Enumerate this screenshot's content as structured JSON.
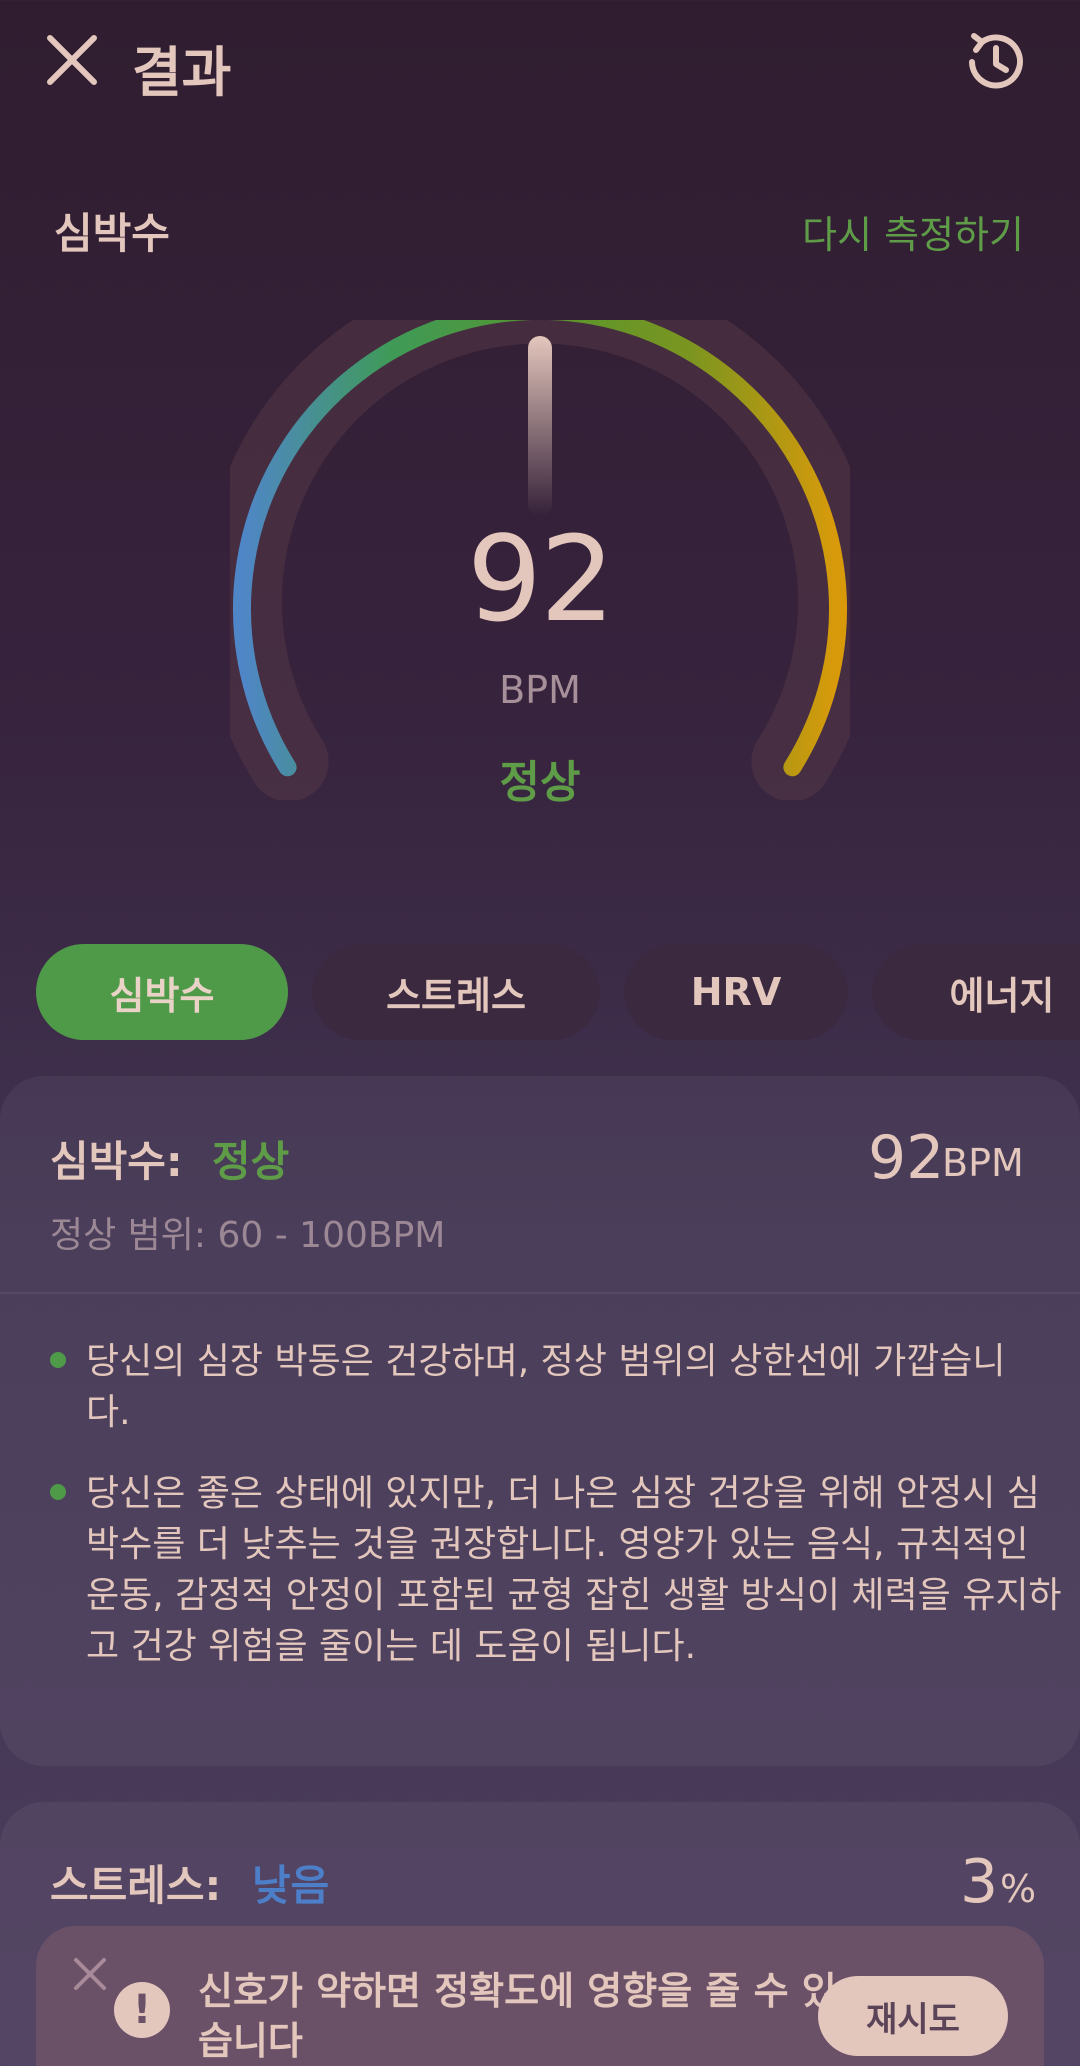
{
  "header": {
    "title": "결과",
    "close_icon": "close-icon",
    "history_icon": "history-icon"
  },
  "heart_rate": {
    "section_title": "심박수",
    "remeasure_label": "다시 측정하기",
    "value": "92",
    "unit": "BPM",
    "status": "정상"
  },
  "tabs": [
    {
      "label": "심박수",
      "active": true
    },
    {
      "label": "스트레스",
      "active": false
    },
    {
      "label": "HRV",
      "active": false
    },
    {
      "label": "에너지",
      "active": false
    }
  ],
  "heart_card": {
    "label": "심박수:",
    "status": "정상",
    "value": "92",
    "unit": "BPM",
    "range": "정상 범위: 60 - 100BPM",
    "bullets": [
      "당신의 심장 박동은 건강하며, 정상 범위의 상한선에 가깝습니다.",
      "당신은 좋은 상태에 있지만, 더 나은 심장 건강을 위해 안정시 심박수를 더 낮추는 것을 권장합니다. 영양가 있는 음식, 규칙적인 운동, 감정적 안정이 포함된 균형 잡힌 생활 방식이 체력을 유지하고 건강 위험을 줄이는 데 도움이 됩니다."
    ]
  },
  "stress_card": {
    "label": "스트레스:",
    "status": "낮음",
    "value": "3",
    "unit": "%"
  },
  "alert": {
    "message": "신호가 약하면 정확도에 영향을 줄 수 있습니다",
    "retry_label": "재시도"
  },
  "colors": {
    "accent_green": "#4f9a48",
    "status_green": "#5f9c48",
    "status_blue": "#4d7ec8",
    "text_primary": "#e3c6bc",
    "text_muted": "#9c8795"
  }
}
